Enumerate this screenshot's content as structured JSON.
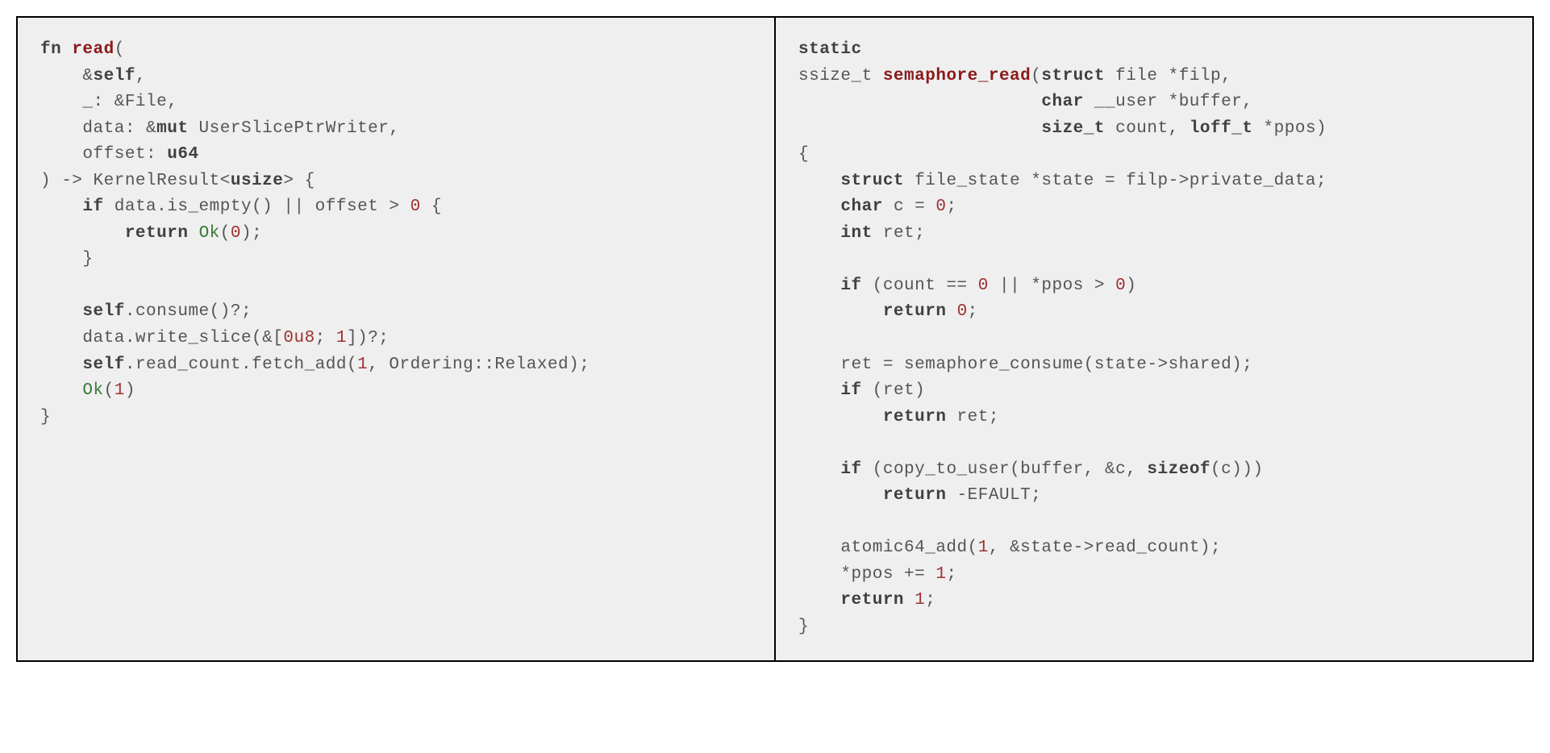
{
  "left": {
    "l1a": "fn ",
    "l1b": "read",
    "l1c": "(",
    "l2a": "    &",
    "l2b": "self",
    "l2c": ",",
    "l3": "    _: &File,",
    "l4a": "    data: &",
    "l4b": "mut",
    "l4c": " UserSlicePtrWriter,",
    "l5a": "    offset: ",
    "l5b": "u64",
    "l6a": ") -> KernelResult<",
    "l6b": "usize",
    "l6c": "> {",
    "l7a": "    ",
    "l7b": "if",
    "l7c": " data.is_empty() || offset > ",
    "l7d": "0",
    "l7e": " {",
    "l8a": "        ",
    "l8b": "return",
    "l8c": " ",
    "l8d": "Ok",
    "l8e": "(",
    "l8f": "0",
    "l8g": ");",
    "l9": "    }",
    "l10": "",
    "l11a": "    ",
    "l11b": "self",
    "l11c": ".consume()?;",
    "l12a": "    data.write_slice(&[",
    "l12b": "0u8",
    "l12c": "; ",
    "l12d": "1",
    "l12e": "])?;",
    "l13a": "    ",
    "l13b": "self",
    "l13c": ".read_count.fetch_add(",
    "l13d": "1",
    "l13e": ", Ordering::Relaxed);",
    "l14a": "    ",
    "l14b": "Ok",
    "l14c": "(",
    "l14d": "1",
    "l14e": ")",
    "l15": "}"
  },
  "right": {
    "r1": "static",
    "r2a": "ssize_t ",
    "r2b": "semaphore_read",
    "r2c": "(",
    "r2d": "struct",
    "r2e": " file *filp,",
    "r3a": "                       ",
    "r3b": "char",
    "r3c": " __user *buffer,",
    "r4a": "                       ",
    "r4b": "size_t",
    "r4c": " count, ",
    "r4d": "loff_t",
    "r4e": " *ppos)",
    "r5": "{",
    "r6a": "    ",
    "r6b": "struct",
    "r6c": " file_state *state = filp->private_data;",
    "r7a": "    ",
    "r7b": "char",
    "r7c": " c = ",
    "r7d": "0",
    "r7e": ";",
    "r8a": "    ",
    "r8b": "int",
    "r8c": " ret;",
    "r9": "",
    "r10a": "    ",
    "r10b": "if",
    "r10c": " (count == ",
    "r10d": "0",
    "r10e": " || *ppos > ",
    "r10f": "0",
    "r10g": ")",
    "r11a": "        ",
    "r11b": "return",
    "r11c": " ",
    "r11d": "0",
    "r11e": ";",
    "r12": "",
    "r13": "    ret = semaphore_consume(state->shared);",
    "r14a": "    ",
    "r14b": "if",
    "r14c": " (ret)",
    "r15a": "        ",
    "r15b": "return",
    "r15c": " ret;",
    "r16": "",
    "r17a": "    ",
    "r17b": "if",
    "r17c": " (copy_to_user(buffer, &c, ",
    "r17d": "sizeof",
    "r17e": "(c)))",
    "r18a": "        ",
    "r18b": "return",
    "r18c": " -EFAULT;",
    "r19": "",
    "r20a": "    atomic64_add(",
    "r20b": "1",
    "r20c": ", &state->read_count);",
    "r21a": "    *ppos += ",
    "r21b": "1",
    "r21c": ";",
    "r22a": "    ",
    "r22b": "return",
    "r22c": " ",
    "r22d": "1",
    "r22e": ";",
    "r23": "}"
  }
}
